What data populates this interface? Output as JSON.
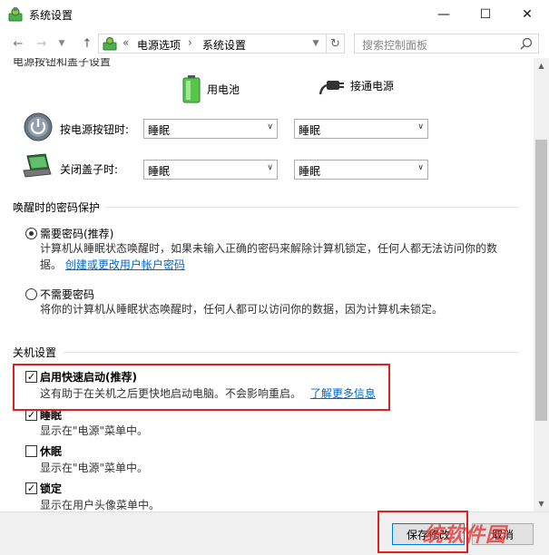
{
  "window": {
    "title": "系统设置",
    "minimize": "—",
    "maximize": "☐",
    "close": "✕"
  },
  "address": {
    "back": "←",
    "forward": "→",
    "up": "↑",
    "sep": "«",
    "crumb1": "电源选项",
    "sep2": "›",
    "crumb2": "系统设置",
    "refresh": "↻",
    "search_placeholder": "搜索控制面板"
  },
  "power": {
    "cut_title": "电源按钮和盖子设置",
    "battery_label": "用电池",
    "plug_label": "接通电源",
    "button_label": "按电源按钮时:",
    "lid_label": "关闭盖子时:",
    "button_battery": "睡眠",
    "button_plug": "睡眠",
    "lid_battery": "睡眠",
    "lid_plug": "睡眠"
  },
  "wake": {
    "title": "唤醒时的密码保护",
    "require_label": "需要密码(推荐)",
    "require_desc1": "计算机从睡眠状态唤醒时，如果未输入正确的密码来解除计算机锁定，任何人都无法访问你的数",
    "require_desc2": "据。",
    "require_link": "创建或更改用户帐户密码",
    "norequire_label": "不需要密码",
    "norequire_desc": "将你的计算机从睡眠状态唤醒时，任何人都可以访问你的数据，因为计算机未锁定。"
  },
  "shutdown": {
    "title": "关机设置",
    "fast_label": "启用快速启动(推荐)",
    "fast_desc": "这有助于在关机之后更快地启动电脑。不会影响重启。",
    "fast_link": "了解更多信息",
    "sleep_label": "睡眠",
    "sleep_desc": "显示在\"电源\"菜单中。",
    "hibernate_label": "休眠",
    "hibernate_desc": "显示在\"电源\"菜单中。",
    "lock_label": "锁定",
    "lock_desc": "显示在用户头像菜单中。"
  },
  "footer": {
    "save": "保存修改",
    "cancel": "取消"
  },
  "watermark": "统软件园",
  "colors": {
    "accent": "#0078d7",
    "highlight": "#e0201e",
    "link": "#0066cc"
  }
}
